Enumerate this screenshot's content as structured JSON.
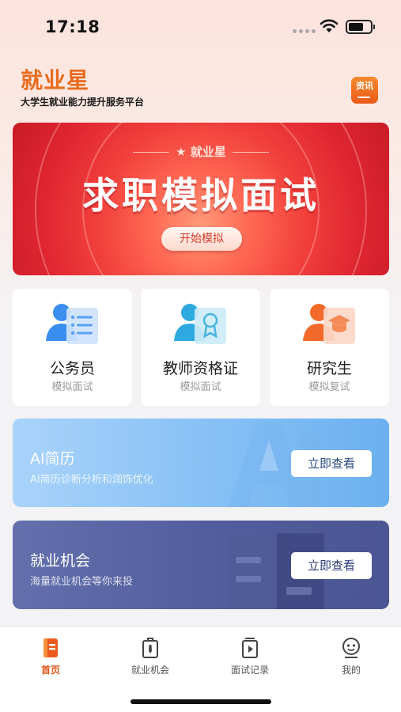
{
  "status_bar": {
    "time": "17:18"
  },
  "header": {
    "brand": "就业星",
    "tagline": "大学生就业能力提升服务平台",
    "news_button": "资讯"
  },
  "hero": {
    "badge": "就业星",
    "title": "求职模拟面试",
    "button": "开始模拟"
  },
  "cards": [
    {
      "title": "公务员",
      "subtitle": "模拟面试",
      "icon": "person-list-icon"
    },
    {
      "title": "教师资格证",
      "subtitle": "模拟面试",
      "icon": "person-certificate-icon"
    },
    {
      "title": "研究生",
      "subtitle": "模拟复试",
      "icon": "person-graduation-icon"
    }
  ],
  "features": [
    {
      "title": "AI简历",
      "subtitle": "AI简历诊断分析和润饰优化",
      "button": "立即查看"
    },
    {
      "title": "就业机会",
      "subtitle": "海量就业机会等你来投",
      "button": "立即查看"
    }
  ],
  "tabbar": {
    "items": [
      {
        "label": "首页",
        "icon": "home-doc-icon",
        "active": true
      },
      {
        "label": "就业机会",
        "icon": "briefcase-tie-icon",
        "active": false
      },
      {
        "label": "面试记录",
        "icon": "video-record-icon",
        "active": false
      },
      {
        "label": "我的",
        "icon": "profile-face-icon",
        "active": false
      }
    ]
  },
  "colors": {
    "brand": "#ea6a1c",
    "hero_red": "#e0282f",
    "ai_blue": "#8cc3f5",
    "job_indigo": "#525e9e",
    "tab_active": "#e2561a"
  }
}
